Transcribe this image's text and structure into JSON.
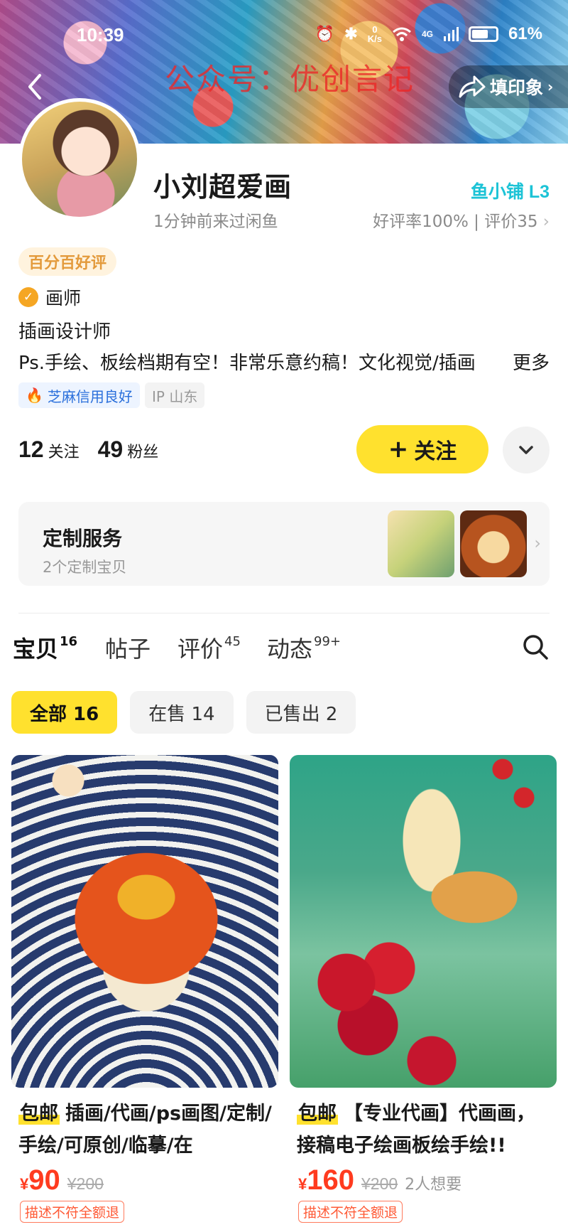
{
  "status_bar": {
    "time": "10:39",
    "battery": "61%",
    "net_speed_top": "0",
    "net_speed_bottom": "K/s",
    "signal": "4G"
  },
  "watermark": "公众号：优创言记",
  "header": {
    "share_label": "填印象"
  },
  "profile": {
    "name": "小刘超爱画",
    "level": "鱼小铺 L3",
    "last_seen": "1分钟前来过闲鱼",
    "rating": "好评率100% | 评价35",
    "good_tag": "百分百好评",
    "role": "画师",
    "bio_line1": "插画设计师",
    "bio_line2": "Ps.手绘、板绘档期有空！非常乐意约稿！文化视觉/插画",
    "bio_more": "更多",
    "credit_chip": "芝麻信用良好",
    "ip_chip": "IP 山东"
  },
  "stats": {
    "following_count": "12",
    "following_label": "关注",
    "fans_count": "49",
    "fans_label": "粉丝"
  },
  "actions": {
    "follow_label": "关注"
  },
  "custom_service": {
    "title": "定制服务",
    "subtitle": "2个定制宝贝"
  },
  "tabs": [
    {
      "label": "宝贝",
      "count": "16"
    },
    {
      "label": "帖子",
      "count": ""
    },
    {
      "label": "评价",
      "count": "45"
    },
    {
      "label": "动态",
      "count": "99+"
    }
  ],
  "filters": [
    {
      "label": "全部 16"
    },
    {
      "label": "在售 14"
    },
    {
      "label": "已售出 2"
    }
  ],
  "products": [
    {
      "badge": "包邮",
      "title": "插画/代画/ps画图/定制/手绘/可原创/临摹/在",
      "currency": "¥",
      "price": "90",
      "orig_price": "¥200",
      "wants": "",
      "refund_tag": "描述不符全额退"
    },
    {
      "badge": "包邮",
      "title": "【专业代画】代画画，接稿电子绘画板绘手绘!!",
      "currency": "¥",
      "price": "160",
      "orig_price": "¥200",
      "wants": "2人想要",
      "refund_tag": "描述不符全额退"
    }
  ],
  "colors": {
    "accent_yellow": "#ffe12e",
    "price_red": "#ff3b1f",
    "level_cyan": "#1cc3d6"
  }
}
